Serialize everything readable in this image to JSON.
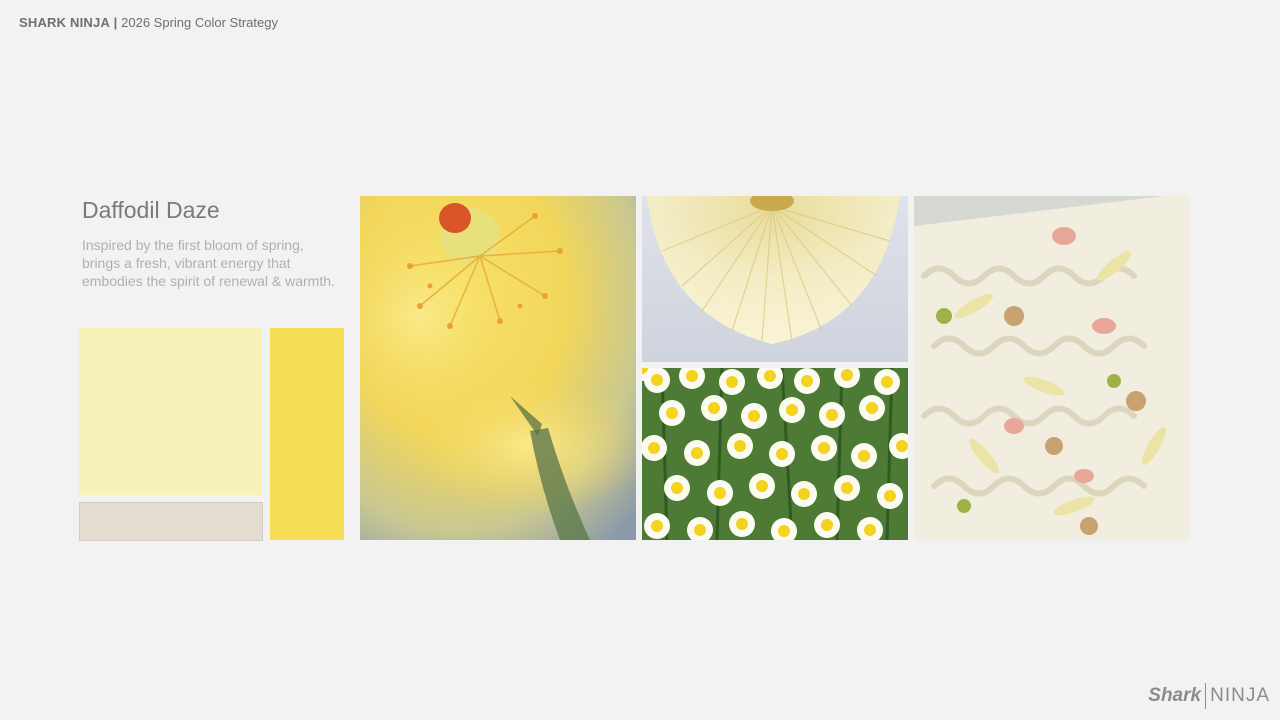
{
  "header": {
    "brand": "SHARK NINJA",
    "separator": "|",
    "subtitle": "2026 Spring Color Strategy"
  },
  "palette": {
    "title": "Daffodil Daze",
    "description_lines": [
      "Inspired by the first bloom of spring,",
      "brings a fresh, vibrant energy that",
      "embodies the spirit of renewal & warmth."
    ],
    "swatches": [
      {
        "name": "pale-yellow",
        "color": "#f6f2b8"
      },
      {
        "name": "warm-stone",
        "color": "#e3dcd1"
      },
      {
        "name": "daffodil-yellow",
        "color": "#f7de58"
      }
    ]
  },
  "images": [
    {
      "name": "yellow-flower-closeup-photo",
      "icon": "flower-photo"
    },
    {
      "name": "ruffled-mushroom-photo",
      "icon": "mushroom-photo"
    },
    {
      "name": "daffodil-field-photo",
      "icon": "daffodil-field-photo"
    },
    {
      "name": "floral-tart-photo",
      "icon": "dessert-photo"
    }
  ],
  "logo": {
    "part1": "Shark",
    "part2": "NINJA",
    "color": "#8c8c8c"
  }
}
